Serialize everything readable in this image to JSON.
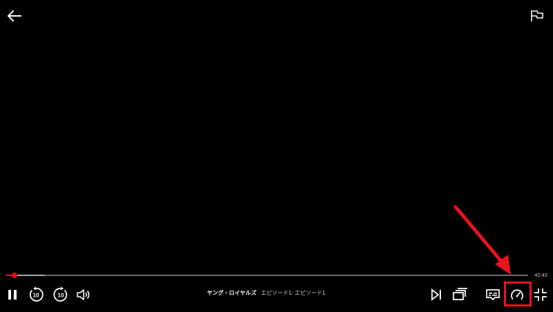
{
  "player": {
    "time_remaining": "42:43",
    "progress_fraction": 0.017,
    "buffer_fraction": 0.075,
    "title": {
      "show": "ヤング・ロイヤルズ",
      "episode": "エピソード1:  エピソード1"
    },
    "controls_left": [
      {
        "name": "pause-icon",
        "label": "pause"
      },
      {
        "name": "rewind-10-icon",
        "label": "10"
      },
      {
        "name": "forward-10-icon",
        "label": "10"
      },
      {
        "name": "volume-icon",
        "label": "volume"
      }
    ],
    "controls_right": [
      {
        "name": "next-episode-icon"
      },
      {
        "name": "episodes-icon"
      },
      {
        "name": "subtitles-icon"
      },
      {
        "name": "playback-speed-icon"
      },
      {
        "name": "exit-fullscreen-icon"
      }
    ]
  },
  "annotation": {
    "color": "#e8141e",
    "target": "playback-speed-button"
  },
  "colors": {
    "accent": "#e50914",
    "background": "#000000",
    "icon": "#ffffff"
  }
}
